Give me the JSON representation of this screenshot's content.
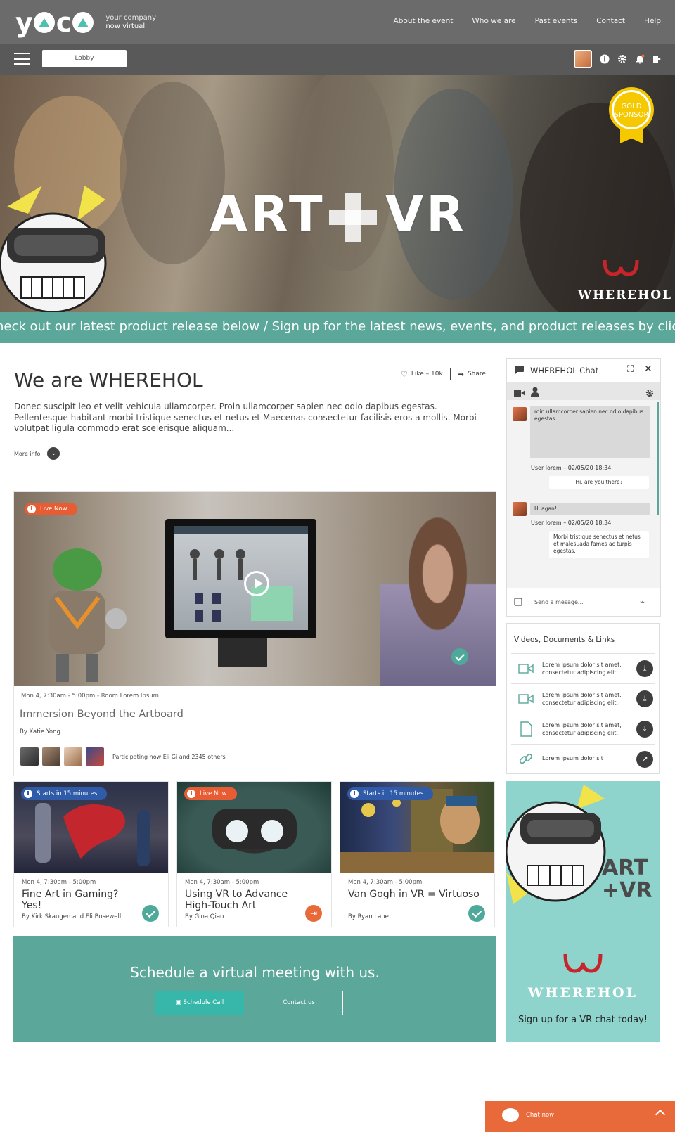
{
  "brand": {
    "logo_text": "yoco",
    "tagline_1": "your company",
    "tagline_2": "now virtual"
  },
  "topnav": [
    "About the event",
    "Who we are",
    "Past events",
    "Contact",
    "Help"
  ],
  "subbar": {
    "lobby_label": "Lobby",
    "icons": [
      "menu-icon",
      "avatar",
      "info-icon",
      "gear-icon",
      "bell-icon",
      "logout-icon"
    ]
  },
  "hero": {
    "title_left": "ART",
    "title_right": "VR",
    "badge_line1": "GOLD",
    "badge_line2": "SPONSOR",
    "brand": "WHEREHOL"
  },
  "ticker": {
    "text": "heck out our latest product release below   /   Sign up for the latest news, events, and product releases by clicking h"
  },
  "intro": {
    "title": "We are WHEREHOL",
    "like_label": "Like – 10k",
    "share_label": "Share",
    "description": "Donec suscipit leo et velit vehicula ullamcorper. Proin ullamcorper sapien nec odio dapibus egestas. Pellentesque habitant morbi tristique senectus et netus et Maecenas consectetur facilisis eros a mollis. Morbi volutpat ligula commodo erat scelerisque aliquam...",
    "more_info": "More info"
  },
  "featured": {
    "status": "Live Now",
    "meta": "Mon 4, 7:30am - 5:00pm  -  Room Lorem Ipsum",
    "title": "Immersion Beyond the Artboard",
    "byline": "By Katie Yong",
    "participants": "Participating now Eli Gi and 2345 others"
  },
  "sessions": [
    {
      "status": "Starts in 15 minutes",
      "meta": "Mon 4, 7:30am - 5:00pm",
      "title": "Fine Art in Gaming? Yes!",
      "byline": "By Kirk Skaugen and Eli Bosewell"
    },
    {
      "status": "Live Now",
      "meta": "Mon 4, 7:30am - 5:00pm",
      "title": "Using VR to Advance High-Touch Art",
      "byline": "By Gina Qiao"
    },
    {
      "status": "Starts in 15 minutes",
      "meta": "Mon 4, 7:30am - 5:00pm",
      "title": "Van Gogh in VR = Virtuoso",
      "byline": "By Ryan Lane"
    }
  ],
  "schedule": {
    "title": "Schedule a virtual meeting with us.",
    "primary": "Schedule Call",
    "secondary": "Contact us"
  },
  "chat": {
    "title": "WHEREHOL Chat",
    "msg1": "roin ullamcorper sapien nec odio dapibus egestas.",
    "meta1": "User lorem –  02/05/20  18:34",
    "reply1": "Hi, are you there?",
    "msg2": "Hi agan!",
    "meta2": "User lorem –  02/05/20  18:34",
    "reply2": "Morbi tristique senectus et netus et malesuada fames ac turpis egestas.",
    "input_placeholder": "Send a mesage..."
  },
  "docs": {
    "title": "Videos, Documents & Links",
    "items": [
      {
        "icon": "video-icon",
        "text": "Lorem ipsum dolor sit amet, consectetur adipiscing elit.",
        "action": "download-icon"
      },
      {
        "icon": "video-icon",
        "text": "Lorem ipsum dolor sit amet, consectetur adipiscing elit.",
        "action": "download-icon"
      },
      {
        "icon": "document-icon",
        "text": "Lorem ipsum dolor sit amet, consectetur adipiscing elit.",
        "action": "download-icon"
      },
      {
        "icon": "link-icon",
        "text": "Lorem ipsum dolor sit",
        "action": "external-link-icon"
      }
    ]
  },
  "ad": {
    "art_line1": "ART",
    "art_line2": "VR",
    "brand": "WHEREHOL",
    "cta": "Sign up for a VR chat today!"
  },
  "chatnow": {
    "label": "Chat now"
  },
  "colors": {
    "teal": "#5ba79a",
    "orange": "#e8693a",
    "blue": "#2f5ba8",
    "topbar": "#6b6b6b",
    "subbar": "#595959"
  }
}
